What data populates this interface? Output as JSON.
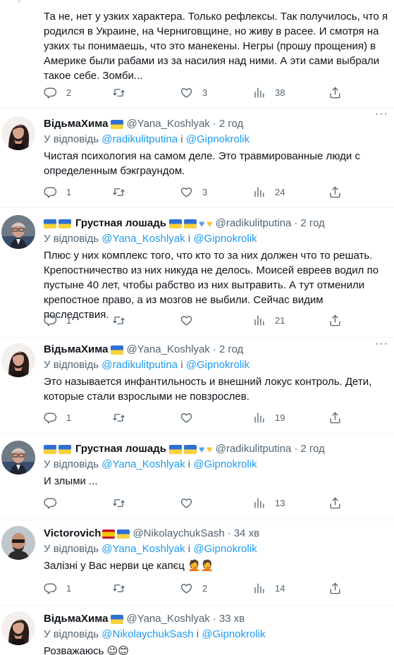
{
  "tweets": [
    {
      "text": "Та не, нет у узких характера. Только рефлексы. Так получилось, что я родился в Украине, на Черниговщине, но живу в расее. И смотря на узких ты понимаешь, что это манекены. Негры (прошу прощения) в Америке были рабами из за насилия над ними. А эти сами выбрали такое себе. Зомби...",
      "replies": "2",
      "retweets": "",
      "likes": "3",
      "views": "38"
    },
    {
      "name": "ВідьмаХима",
      "handle": "@Yana_Koshlyak",
      "time": "2 год",
      "reply_label": "У відповідь",
      "mention1": "@radikulitputina",
      "conj": "і",
      "mention2": "@Gipnokrolik",
      "text": "Чистая психология на самом деле. Это травмированные люди с определенным бэкграундом.",
      "replies": "1",
      "retweets": "",
      "likes": "3",
      "views": "24"
    },
    {
      "name": "Грустная лошадь",
      "handle": "@radikulitputina",
      "time": "2 год",
      "reply_label": "У відповідь",
      "mention1": "@Yana_Koshlyak",
      "conj": "і",
      "mention2": "@Gipnokrolik",
      "text": "Плюс у них комплекс того, что кто то за них должен что то решать. Крепостничество из них никуда не делось. Моисей евреев водил по пустыне 40 лет, чтобы рабство из них вытравить. А тут отменили крепостное право, а из мозгов не выбили. Сейчас видим последствия.",
      "replies": "1",
      "retweets": "",
      "likes": "",
      "views": "21"
    },
    {
      "name": "ВідьмаХима",
      "handle": "@Yana_Koshlyak",
      "time": "2 год",
      "reply_label": "У відповідь",
      "mention1": "@radikulitputina",
      "conj": "і",
      "mention2": "@Gipnokrolik",
      "text": "Это называется инфантильность и внешний локус контроль. Дети, которые стали взрослыми не повзрослев.",
      "replies": "1",
      "retweets": "",
      "likes": "",
      "views": "19"
    },
    {
      "name": "Грустная лошадь",
      "handle": "@radikulitputina",
      "time": "2 год",
      "reply_label": "У відповідь",
      "mention1": "@Yana_Koshlyak",
      "conj": "і",
      "mention2": "@Gipnokrolik",
      "text": "И злыми ...",
      "replies": "",
      "retweets": "",
      "likes": "",
      "views": "13"
    },
    {
      "name": "Victorovich",
      "handle": "@NikolaychukSash",
      "time": "34 хв",
      "reply_label": "У відповідь",
      "mention1": "@Yana_Koshlyak",
      "conj": "і",
      "mention2": "@Gipnokrolik",
      "text": "Залізні у Вас нерви це капєц 🤦🤦",
      "replies": "1",
      "retweets": "",
      "likes": "2",
      "views": "14"
    },
    {
      "name": "ВідьмаХима",
      "handle": "@Yana_Koshlyak",
      "time": "33 хв",
      "reply_label": "У відповідь",
      "mention1": "@NikolaychukSash",
      "conj": "і",
      "mention2": "@Gipnokrolik",
      "text": "Розважаюсь 😉😊"
    }
  ],
  "icons": [
    "reply-icon",
    "retweet-icon",
    "like-icon",
    "views-icon",
    "share-icon",
    "more-icon"
  ],
  "colors": {
    "link": "#1d9bf0",
    "secondary": "#536471",
    "text": "#0f1419",
    "divider": "#eff3f4"
  }
}
